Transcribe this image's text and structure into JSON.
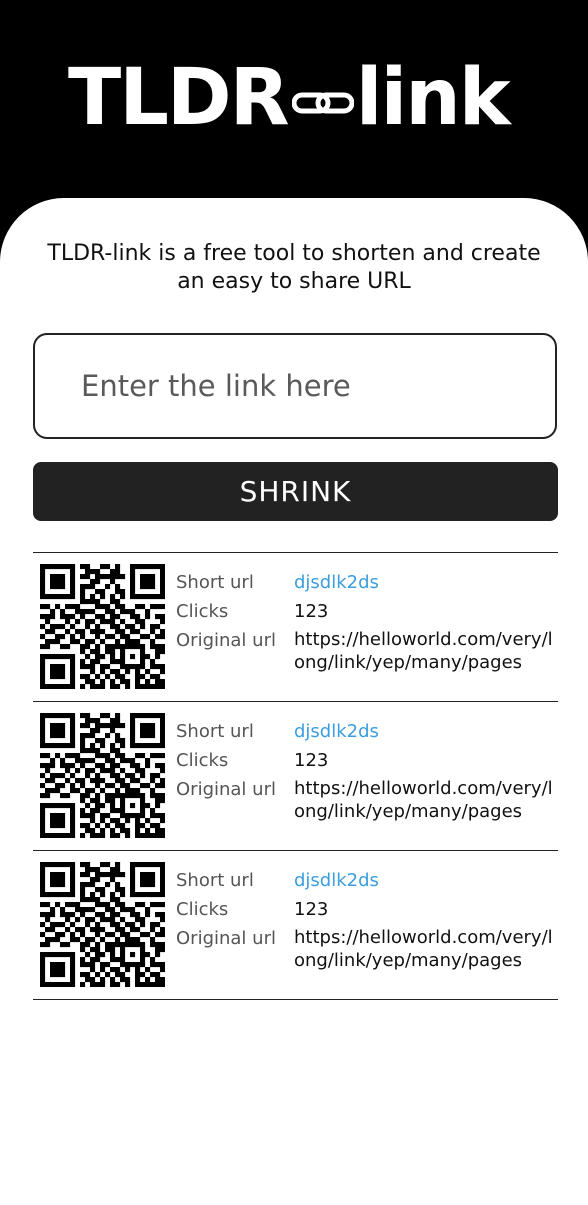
{
  "header": {
    "logo_left": "TLDR",
    "logo_right": "link",
    "chain_icon": "link-chain-icon"
  },
  "intro": {
    "tagline": "TLDR-link is a free tool to shorten and create an easy to share URL"
  },
  "form": {
    "placeholder": "Enter the link here",
    "value": "",
    "button_label": "SHRINK"
  },
  "labels": {
    "short": "Short url",
    "clicks": "Clicks",
    "original": "Original url"
  },
  "results": [
    {
      "short_url": "djsdlk2ds",
      "clicks": "123",
      "original_url": "https://helloworld.com/very/long/link/yep/many/pages"
    },
    {
      "short_url": "djsdlk2ds",
      "clicks": "123",
      "original_url": "https://helloworld.com/very/long/link/yep/many/pages"
    },
    {
      "short_url": "djsdlk2ds",
      "clicks": "123",
      "original_url": "https://helloworld.com/very/long/link/yep/many/pages"
    }
  ],
  "colors": {
    "header_bg": "#000000",
    "card_bg": "#ffffff",
    "button_bg": "#222222",
    "link": "#3b9de0"
  }
}
